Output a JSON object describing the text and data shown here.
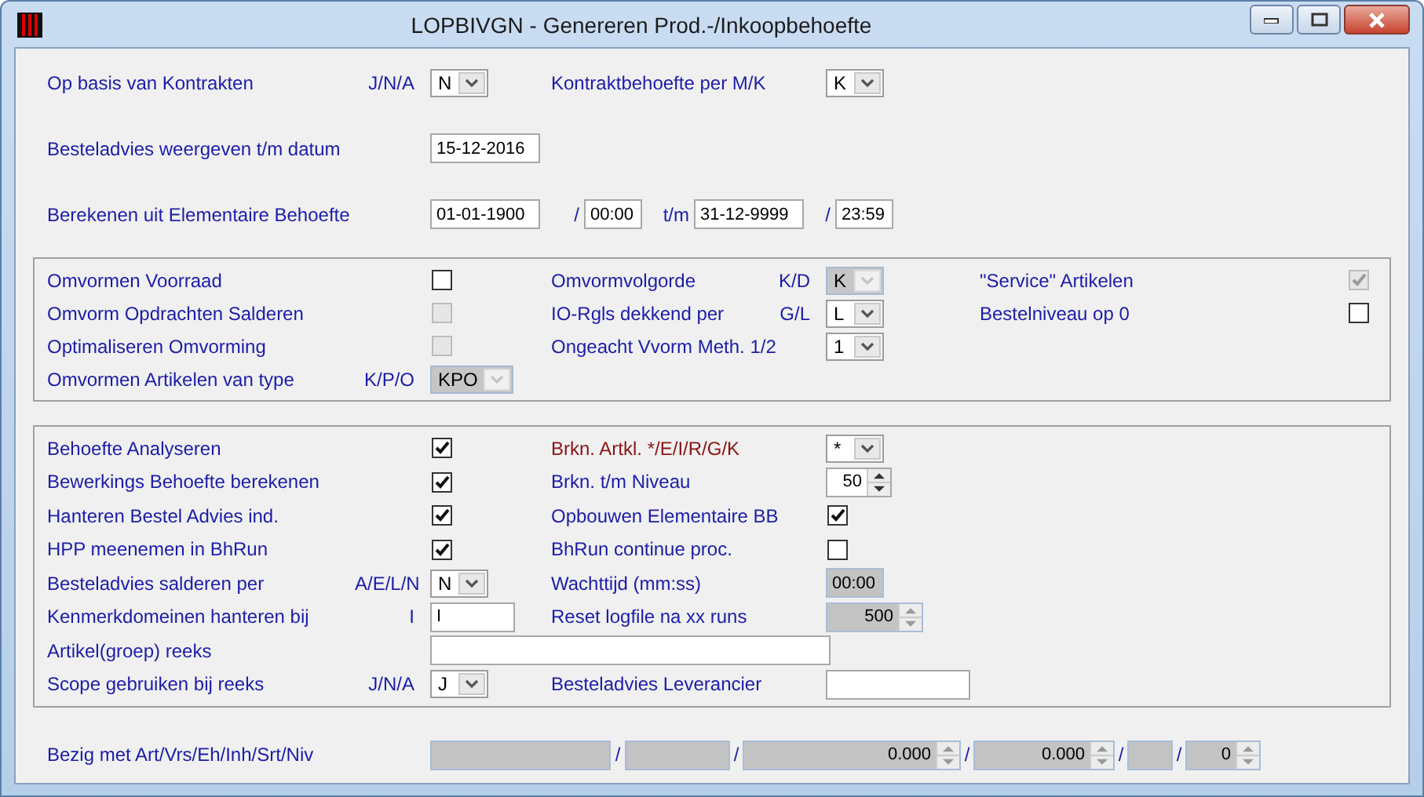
{
  "window": {
    "title": "LOPBIVGN - Genereren Prod.-/Inkoopbehoefte"
  },
  "header_rows": [
    {
      "left": {
        "label": "Op basis van Kontrakten",
        "hint": "J/N/A",
        "controls": [
          {
            "kind": "select",
            "value": "N",
            "disabled": false
          }
        ]
      },
      "middle": {
        "label": "Kontraktbehoefte per M/K",
        "controls": [
          {
            "kind": "select",
            "value": "K",
            "disabled": false
          }
        ]
      }
    },
    {
      "left": {
        "label": "Besteladvies weergeven t/m datum",
        "controls": [
          {
            "kind": "field",
            "value": "15-12-2016",
            "disabled": false
          }
        ]
      }
    },
    {
      "left": {
        "label": "Berekenen uit Elementaire Behoefte",
        "controls": [
          {
            "kind": "field",
            "value": "01-01-1900",
            "disabled": false
          },
          {
            "kind": "separator",
            "text": "/"
          },
          {
            "kind": "field",
            "value": "00:00",
            "disabled": false
          },
          {
            "kind": "separator",
            "text": "t/m"
          },
          {
            "kind": "field",
            "value": "31-12-9999",
            "disabled": false
          },
          {
            "kind": "separator",
            "text": "/"
          },
          {
            "kind": "field",
            "value": "23:59",
            "disabled": false
          }
        ]
      }
    }
  ],
  "groups": [
    {
      "rows": [
        {
          "left": {
            "label": "Omvormen Voorraad",
            "controls": [
              {
                "kind": "checkbox",
                "checked": false,
                "disabled": false
              }
            ]
          },
          "middle": {
            "label": "Omvormvolgorde",
            "hint": "K/D",
            "controls": [
              {
                "kind": "select",
                "value": "K",
                "disabled": true
              }
            ]
          },
          "right": {
            "label": "\"Service\" Artikelen",
            "controls": [
              {
                "kind": "checkbox",
                "checked": true,
                "disabled": true
              }
            ]
          }
        },
        {
          "left": {
            "label": "Omvorm Opdrachten Salderen",
            "controls": [
              {
                "kind": "checkbox",
                "checked": false,
                "disabled": true
              }
            ]
          },
          "middle": {
            "label": "IO-Rgls dekkend per",
            "hint": "G/L",
            "controls": [
              {
                "kind": "select",
                "value": "L",
                "disabled": false
              }
            ]
          },
          "right": {
            "label": "Bestelniveau op 0",
            "controls": [
              {
                "kind": "checkbox",
                "checked": false,
                "disabled": false
              }
            ]
          }
        },
        {
          "left": {
            "label": "Optimaliseren Omvorming",
            "controls": [
              {
                "kind": "checkbox",
                "checked": false,
                "disabled": true
              }
            ]
          },
          "middle": {
            "label": "Ongeacht Vvorm Meth. 1/2",
            "controls": [
              {
                "kind": "select",
                "value": "1",
                "disabled": false
              }
            ]
          }
        },
        {
          "left": {
            "label": "Omvormen Artikelen van type",
            "hint": "K/P/O",
            "controls": [
              {
                "kind": "select",
                "value": "KPO",
                "disabled": true
              }
            ]
          }
        }
      ]
    },
    {
      "rows": [
        {
          "left": {
            "label": "Behoefte Analyseren",
            "controls": [
              {
                "kind": "checkbox",
                "checked": true,
                "disabled": false
              }
            ]
          },
          "middle": {
            "label": "Brkn. Artkl. */E/I/R/G/K",
            "color": "#8b1414",
            "controls": [
              {
                "kind": "select",
                "value": "*",
                "disabled": false
              }
            ]
          }
        },
        {
          "left": {
            "label": "Bewerkings Behoefte berekenen",
            "controls": [
              {
                "kind": "checkbox",
                "checked": true,
                "disabled": false
              }
            ]
          },
          "middle": {
            "label": "Brkn. t/m Niveau",
            "controls": [
              {
                "kind": "spin",
                "value": "50",
                "disabled": false
              }
            ]
          }
        },
        {
          "left": {
            "label": "Hanteren Bestel Advies ind.",
            "controls": [
              {
                "kind": "checkbox",
                "checked": true,
                "disabled": false
              }
            ]
          },
          "middle": {
            "label": "Opbouwen Elementaire BB",
            "controls": [
              {
                "kind": "checkbox",
                "checked": true,
                "disabled": false
              }
            ]
          }
        },
        {
          "left": {
            "label": "HPP meenemen in BhRun",
            "controls": [
              {
                "kind": "checkbox",
                "checked": true,
                "disabled": false
              }
            ]
          },
          "middle": {
            "label": "BhRun continue proc.",
            "controls": [
              {
                "kind": "checkbox",
                "checked": false,
                "disabled": false
              }
            ]
          }
        },
        {
          "left": {
            "label": "Besteladvies salderen per",
            "hint": "A/E/L/N",
            "controls": [
              {
                "kind": "select",
                "value": "N",
                "disabled": false
              }
            ]
          },
          "middle": {
            "label": "Wachttijd (mm:ss)",
            "controls": [
              {
                "kind": "field",
                "value": "00:00",
                "disabled": true
              }
            ]
          }
        },
        {
          "left": {
            "label": "Kenmerkdomeinen hanteren bij",
            "hint": "I",
            "controls": [
              {
                "kind": "field",
                "value": "I",
                "disabled": false
              }
            ]
          },
          "middle": {
            "label": "Reset logfile na xx runs",
            "controls": [
              {
                "kind": "spin",
                "value": "500",
                "disabled": true
              }
            ]
          }
        },
        {
          "left": {
            "label": "Artikel(groep) reeks",
            "controls": [
              {
                "kind": "field",
                "disabled": false
              }
            ]
          }
        },
        {
          "left": {
            "label": "Scope gebruiken bij reeks",
            "hint": "J/N/A",
            "controls": [
              {
                "kind": "select",
                "value": "J",
                "disabled": false
              }
            ]
          },
          "middle": {
            "label": "Besteladvies Leverancier",
            "controls": [
              {
                "kind": "field",
                "disabled": false
              }
            ]
          }
        }
      ]
    }
  ],
  "progress": {
    "label": "Bezig met Art/Vrs/Eh/Inh/Srt/Niv",
    "controls": [
      {
        "kind": "field",
        "disabled": true
      },
      {
        "kind": "separator",
        "text": "/"
      },
      {
        "kind": "field",
        "disabled": true
      },
      {
        "kind": "separator",
        "text": "/"
      },
      {
        "kind": "spin",
        "value": "0.000",
        "disabled": true
      },
      {
        "kind": "separator",
        "text": "/"
      },
      {
        "kind": "spin",
        "value": "0.000",
        "disabled": true
      },
      {
        "kind": "separator",
        "text": "/"
      },
      {
        "kind": "field",
        "disabled": true
      },
      {
        "kind": "separator",
        "text": "/"
      },
      {
        "kind": "spin",
        "value": "0",
        "disabled": true
      }
    ]
  }
}
